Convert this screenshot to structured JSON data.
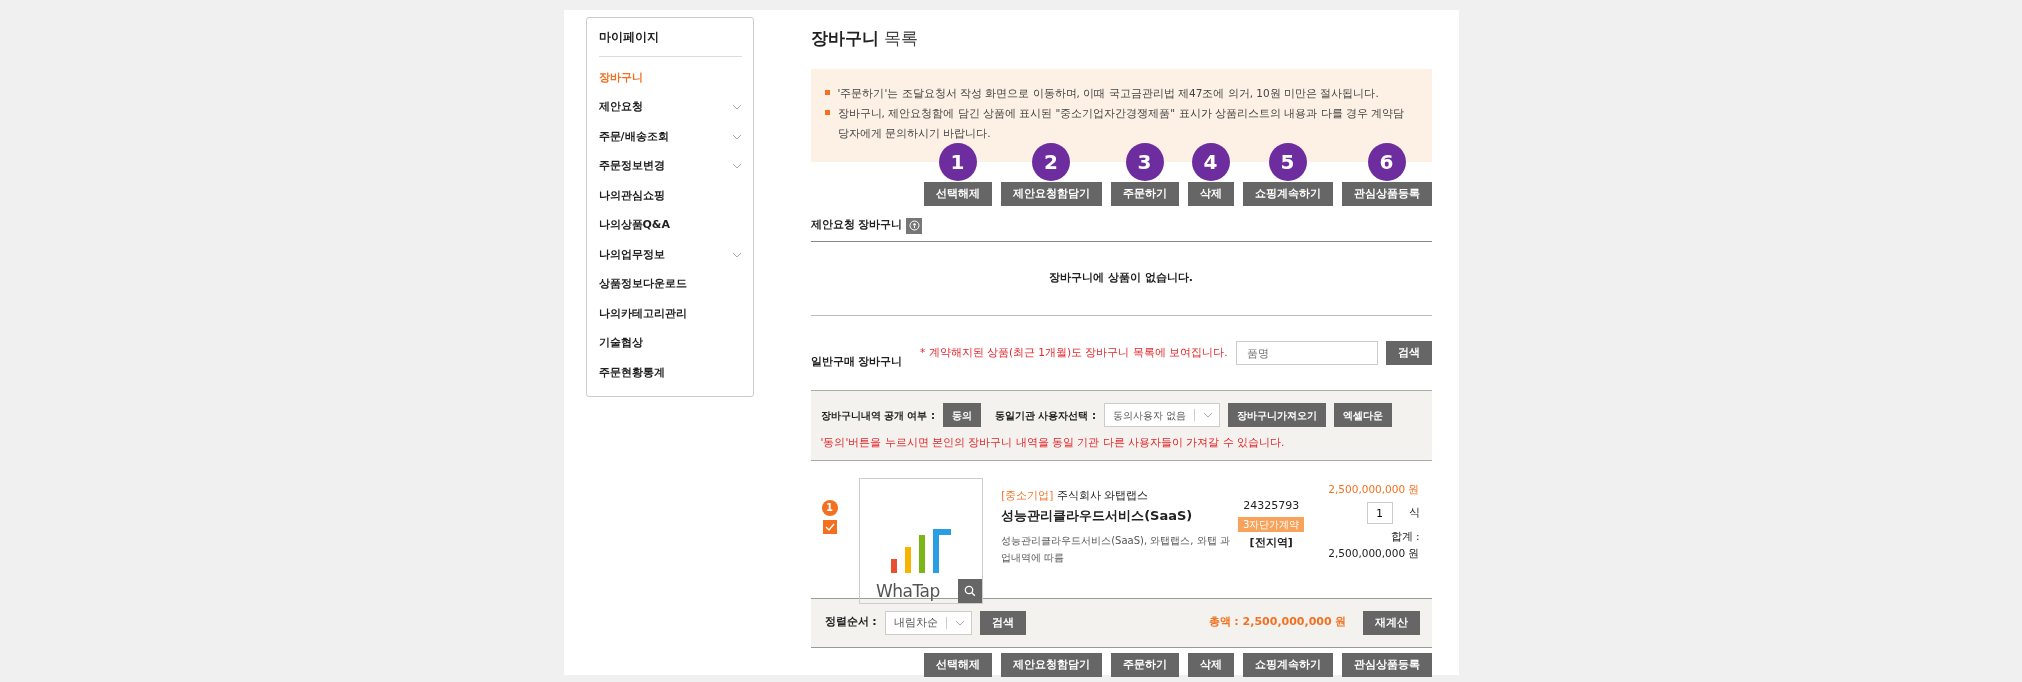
{
  "sidebar": {
    "title": "마이페이지",
    "items": [
      {
        "label": "장바구니",
        "selected": true,
        "expandable": false
      },
      {
        "label": "제안요청",
        "selected": false,
        "expandable": true
      },
      {
        "label": "주문/배송조회",
        "selected": false,
        "expandable": true
      },
      {
        "label": "주문정보변경",
        "selected": false,
        "expandable": true
      },
      {
        "label": "나의관심쇼핑",
        "selected": false,
        "expandable": false
      },
      {
        "label": "나의상품Q&A",
        "selected": false,
        "expandable": false
      },
      {
        "label": "나의업무정보",
        "selected": false,
        "expandable": true
      },
      {
        "label": "상품정보다운로드",
        "selected": false,
        "expandable": false
      },
      {
        "label": "나의카테고리관리",
        "selected": false,
        "expandable": false
      },
      {
        "label": "기술협상",
        "selected": false,
        "expandable": false
      },
      {
        "label": "주문현황통계",
        "selected": false,
        "expandable": false
      }
    ]
  },
  "page_title": {
    "main": "장바구니",
    "sub": "목록"
  },
  "notices": [
    "'주문하기'는 조달요청서 작성 화면으로 이동하며, 이때 국고금관리법 제47조에 의거, 10원 미만은 절사됩니다.",
    "장바구니, 제안요청함에 담긴 상품에 표시된 \"중소기업자간경쟁제품\" 표시가 상품리스트의 내용과 다를 경우 계약담당자에게 문의하시기 바랍니다."
  ],
  "action_buttons_top": [
    {
      "label": "선택해제",
      "callout": "1"
    },
    {
      "label": "제안요청함담기",
      "callout": "2"
    },
    {
      "label": "주문하기",
      "callout": "3"
    },
    {
      "label": "삭제",
      "callout": "4"
    },
    {
      "label": "쇼핑계속하기",
      "callout": "5"
    },
    {
      "label": "관심상품등록",
      "callout": "6"
    }
  ],
  "proposal_cart": {
    "title": "제안요청 장바구니",
    "empty_message": "장바구니에 상품이 없습니다."
  },
  "general_cart": {
    "title": "일반구매 장바구니",
    "notice": "* 계약해지된 상품(최근 1개월)도 장바구니 목록에 보여집니다.",
    "search": {
      "placeholder": "품명",
      "button": "검색"
    }
  },
  "share": {
    "label": "장바구니내역 공개 여부 :",
    "agree_button": "동의",
    "user_select_label": "동일기관 사용자선택 :",
    "user_select_value": "동의사용자 없음",
    "buttons": [
      "장바구니가져오기",
      "엑셀다운"
    ],
    "notice": "'동의'버튼을 누르시면 본인의 장바구니 내역을 동일 기관 다른 사용자들이 가져갈 수 있습니다."
  },
  "items": [
    {
      "index": "1",
      "checked": true,
      "image_caption": "WhaTap",
      "company_tag": "[중소기업]",
      "company": "주식회사 와탭랩스",
      "name": "성능관리클라우드서비스(SaaS)",
      "description": "성능관리클라우드서비스(SaaS), 와탭랩스, 와탭 과업내역에 따름",
      "code": "24325793",
      "contract_tag": "3자단가계약",
      "region": "[전지역]",
      "price": "2,500,000,000 원",
      "quantity": "1",
      "unit": "식",
      "subtotal_label": "합계 :",
      "subtotal": "2,500,000,000 원"
    }
  ],
  "sort": {
    "label": "정렬순서 :",
    "value": "내림차순",
    "button": "검색",
    "total": "총액 : 2,500,000,000 원",
    "recalc_button": "재계산"
  },
  "action_buttons_bottom": [
    {
      "label": "선택해제"
    },
    {
      "label": "제안요청함담기"
    },
    {
      "label": "주문하기"
    },
    {
      "label": "삭제"
    },
    {
      "label": "쇼핑계속하기"
    },
    {
      "label": "관심상품등록"
    }
  ]
}
